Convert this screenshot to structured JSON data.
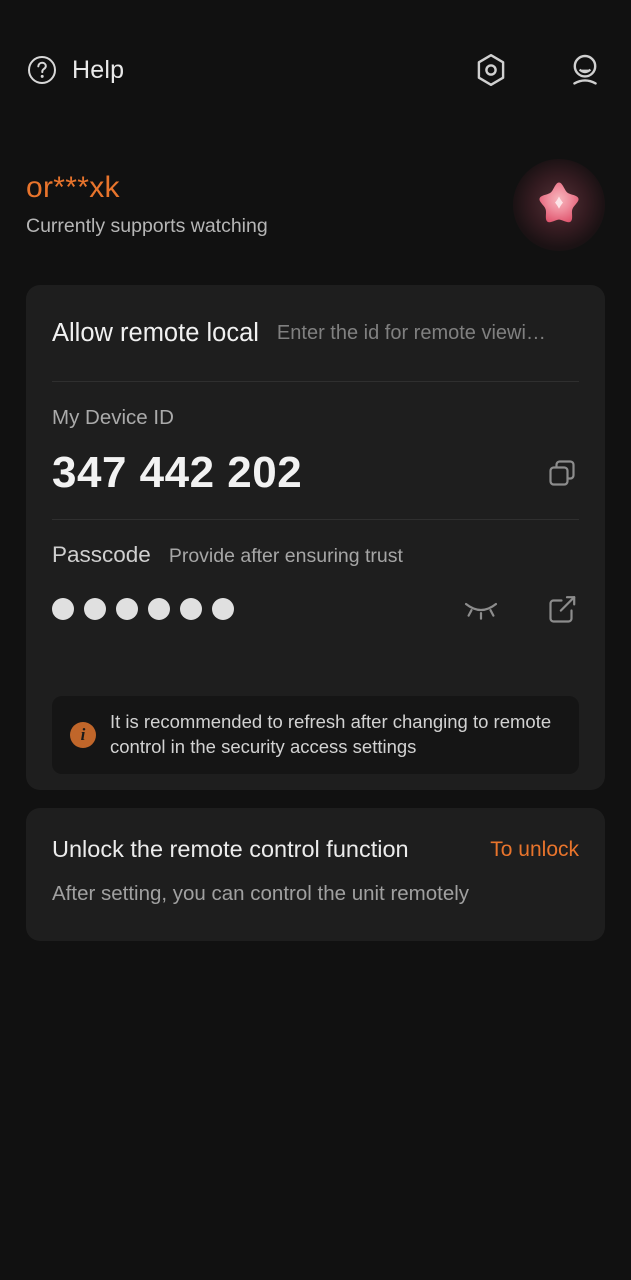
{
  "theme": {
    "page_bg": "#111111",
    "card_bg": "#1e1e1e",
    "banner_bg": "#151515",
    "accent_orange": "#e8742c",
    "divider": "#2f2f2f",
    "text_primary": "#f1f1f1",
    "text_secondary": "#a6a6a6",
    "dot_color": "#e0e0e0",
    "info_icon_bg": "#c0662a"
  },
  "topbar": {
    "help_label": "Help",
    "help_icon": "question-circle-icon",
    "settings_icon": "hex-gear-icon",
    "account_icon": "person-icon"
  },
  "profile": {
    "name": "or***xk",
    "status": "Currently supports watching",
    "avatar_icon": "star-avatar-icon"
  },
  "remote_card": {
    "allow_title": "Allow remote local",
    "allow_placeholder": "Enter the id for remote viewi…",
    "allow_value": "",
    "device_label": "My Device ID",
    "device_id": "347 442 202",
    "copy_icon": "copy-icon",
    "passcode_title": "Passcode",
    "passcode_hint": "Provide after ensuring trust",
    "passcode_dot_count": 6,
    "eye_off_icon": "eye-off-icon",
    "edit_icon": "edit-square-icon",
    "banner_icon": "info-icon",
    "banner_text": "It is recommended to refresh after changing to remote control in the security access settings"
  },
  "unlock_card": {
    "title": "Unlock the remote control function",
    "action_label": "To unlock",
    "subtitle": "After setting, you can control the unit remotely"
  }
}
